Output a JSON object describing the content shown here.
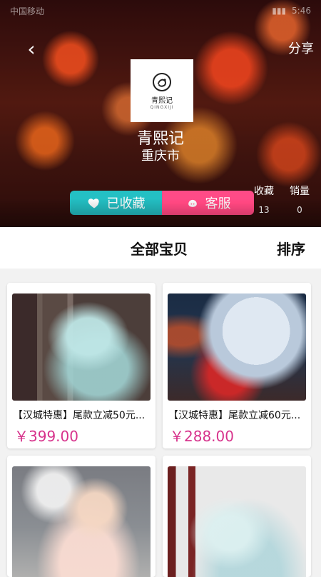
{
  "status_bar": {
    "left_text": "中国移动",
    "right_text": "5:46"
  },
  "header": {
    "share_label": "分享",
    "shop_logo": {
      "name_text": "青熙记",
      "sub_text": "QINGXIJI"
    },
    "shop_name": "青熙记",
    "shop_city": "重庆市",
    "actions": {
      "favorite_label": "已收藏",
      "customer_service_label": "客服"
    },
    "stats": {
      "favorites_label": "收藏",
      "favorites_value": "13",
      "sales_label": "销量",
      "sales_value": "0"
    }
  },
  "tabs": {
    "all_items_label": "全部宝贝",
    "sort_label": "排序"
  },
  "products": [
    {
      "title": "【汉城特惠】尾款立减50元...",
      "price": "￥399.00"
    },
    {
      "title": "【汉城特惠】尾款立减60元...",
      "price": "￥288.00"
    },
    {
      "title": "",
      "price": ""
    },
    {
      "title": "",
      "price": ""
    }
  ],
  "colors": {
    "favorite_button": "#2fbdc1",
    "service_button": "#ff4f86",
    "price": "#d7338c"
  }
}
